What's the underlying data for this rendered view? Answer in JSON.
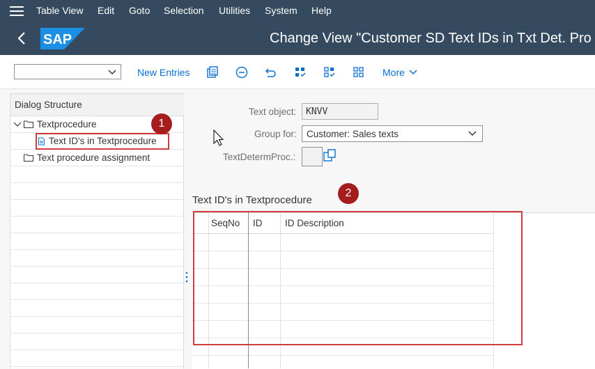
{
  "menu": {
    "items": [
      "Table View",
      "Edit",
      "Goto",
      "Selection",
      "Utilities",
      "System",
      "Help"
    ]
  },
  "header": {
    "logo_text": "SAP",
    "title": "Change View \"Customer SD Text IDs in Txt Det. Pro"
  },
  "toolbar": {
    "new_entries": "New Entries",
    "more": "More"
  },
  "dialog_structure": {
    "title": "Dialog Structure",
    "items": [
      "Textprocedure",
      "Text ID's in Textprocedure",
      "Text procedure assignment"
    ]
  },
  "form": {
    "text_object_label": "Text object:",
    "text_object_value": "KNVV",
    "group_for_label": "Group for:",
    "group_for_value": "Customer: Sales texts",
    "textdeterm_label": "TextDetermProc.:"
  },
  "table": {
    "title": "Text ID's in Textprocedure",
    "columns": [
      "SeqNo",
      "ID",
      "ID Description"
    ]
  },
  "callouts": [
    "1",
    "2"
  ],
  "colors": {
    "shell": "#354a5f",
    "link": "#0a6ed1",
    "callout": "#a51d1d"
  }
}
